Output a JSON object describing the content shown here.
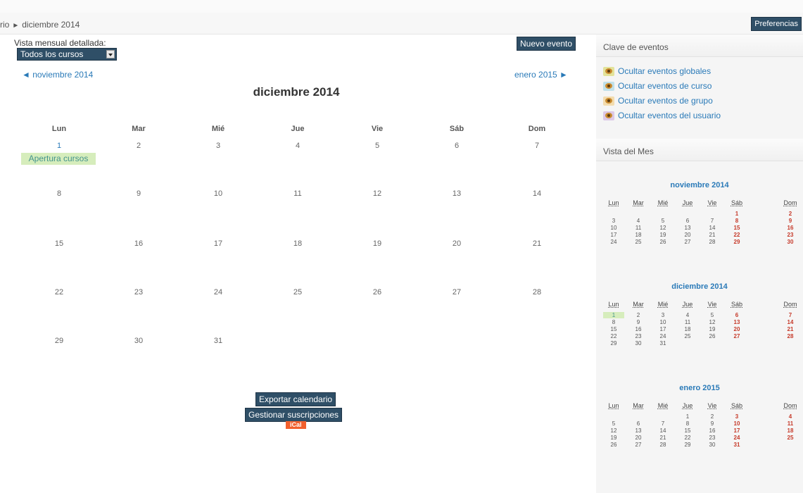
{
  "breadcrumb": {
    "prev": "rio",
    "sep": "►",
    "current": "diciembre 2014"
  },
  "header": {
    "preferences_label": "Preferencias"
  },
  "main": {
    "view_label": "Vista mensual detallada:",
    "course_select_value": "Todos los cursos",
    "new_event_label": "Nuevo evento",
    "prev_month_label": "◄ noviembre 2014",
    "next_month_label": "enero 2015 ►",
    "month_title": "diciembre 2014",
    "weekdays": [
      "Lun",
      "Mar",
      "Mié",
      "Jue",
      "Vie",
      "Sáb",
      "Dom"
    ],
    "weeks": [
      [
        "1",
        "2",
        "3",
        "4",
        "5",
        "6",
        "7"
      ],
      [
        "8",
        "9",
        "10",
        "11",
        "12",
        "13",
        "14"
      ],
      [
        "15",
        "16",
        "17",
        "18",
        "19",
        "20",
        "21"
      ],
      [
        "22",
        "23",
        "24",
        "25",
        "26",
        "27",
        "28"
      ],
      [
        "29",
        "30",
        "31",
        "",
        "",
        "",
        ""
      ]
    ],
    "event_label": "Apertura cursos",
    "export_label": "Exportar calendario",
    "manage_label": "Gestionar suscripciones",
    "ical_label": "iCal"
  },
  "sidebar": {
    "key_title": "Clave de eventos",
    "key_items": [
      {
        "label": "Ocultar eventos globales",
        "color": "#e3e39a"
      },
      {
        "label": "Ocultar eventos de curso",
        "color": "#bfe0ea"
      },
      {
        "label": "Ocultar eventos de grupo",
        "color": "#f3dcae"
      },
      {
        "label": "Ocultar eventos del usuario",
        "color": "#dcc8e6"
      }
    ],
    "month_view_title": "Vista del Mes",
    "mini_weekdays": [
      "Lun",
      "Mar",
      "Mié",
      "Jue",
      "Vie",
      "Sáb",
      "Dom"
    ],
    "mini_calendars": [
      {
        "title": "noviembre 2014",
        "weeks": [
          [
            "",
            "",
            "",
            "",
            "",
            "1",
            "2"
          ],
          [
            "3",
            "4",
            "5",
            "6",
            "7",
            "8",
            "9"
          ],
          [
            "10",
            "11",
            "12",
            "13",
            "14",
            "15",
            "16"
          ],
          [
            "17",
            "18",
            "19",
            "20",
            "21",
            "22",
            "23"
          ],
          [
            "24",
            "25",
            "26",
            "27",
            "28",
            "29",
            "30"
          ]
        ]
      },
      {
        "title": "diciembre 2014",
        "weeks": [
          [
            "1",
            "2",
            "3",
            "4",
            "5",
            "6",
            "7"
          ],
          [
            "8",
            "9",
            "10",
            "11",
            "12",
            "13",
            "14"
          ],
          [
            "15",
            "16",
            "17",
            "18",
            "19",
            "20",
            "21"
          ],
          [
            "22",
            "23",
            "24",
            "25",
            "26",
            "27",
            "28"
          ],
          [
            "29",
            "30",
            "31",
            "",
            "",
            "",
            ""
          ]
        ]
      },
      {
        "title": "enero 2015",
        "weeks": [
          [
            "",
            "",
            "",
            "1",
            "2",
            "3",
            "4"
          ],
          [
            "5",
            "6",
            "7",
            "8",
            "9",
            "10",
            "11"
          ],
          [
            "12",
            "13",
            "14",
            "15",
            "16",
            "17",
            "18"
          ],
          [
            "19",
            "20",
            "21",
            "22",
            "23",
            "24",
            "25"
          ],
          [
            "26",
            "27",
            "28",
            "29",
            "30",
            "31",
            ""
          ]
        ]
      }
    ]
  },
  "colors": {
    "accent": "#2a7ab8",
    "button_dark": "#2f4f67",
    "event_bg": "#d6edbc",
    "weekend": "#c63a2a",
    "ical": "#f2602d"
  }
}
